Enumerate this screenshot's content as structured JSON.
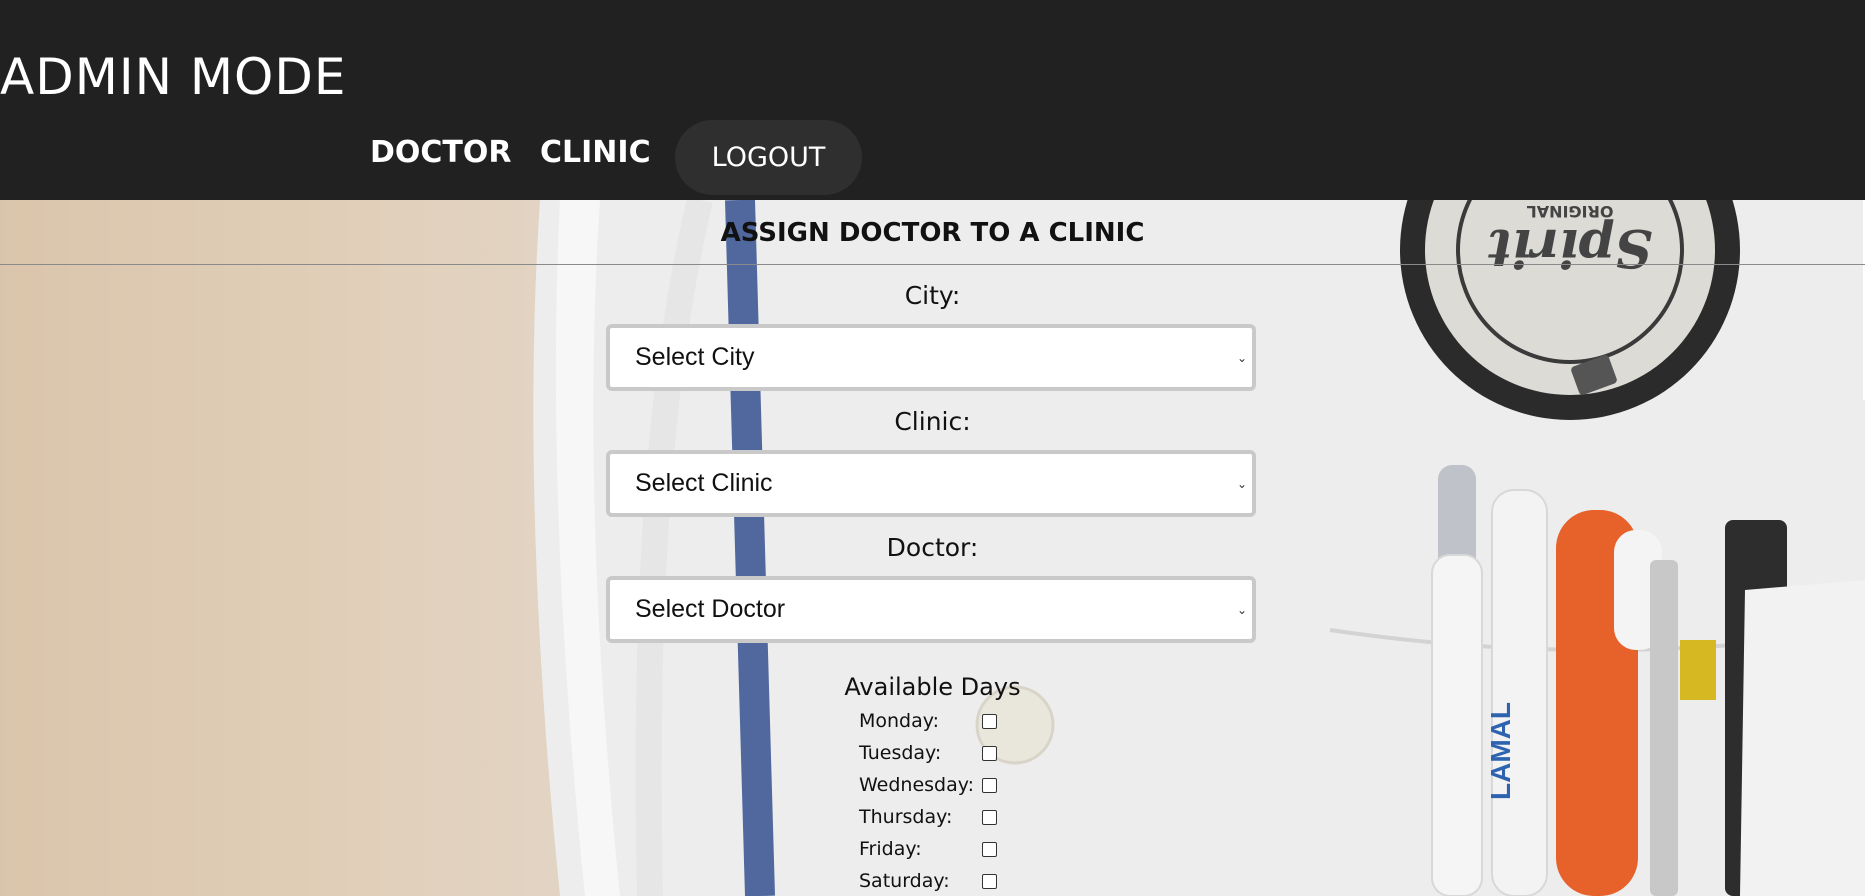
{
  "header": {
    "title": "ADMIN MODE",
    "nav": {
      "doctor_label": "DOCTOR",
      "clinic_label": "CLINIC",
      "logout_label": "LOGOUT"
    }
  },
  "form": {
    "title": "ASSIGN DOCTOR TO A CLINIC",
    "fields": [
      {
        "label": "City:",
        "value": "Select City"
      },
      {
        "label": "Clinic:",
        "value": "Select Clinic"
      },
      {
        "label": "Doctor:",
        "value": "Select Doctor"
      }
    ],
    "days_title": "Available Days",
    "days": [
      {
        "label": "Monday:",
        "checked": false
      },
      {
        "label": "Tuesday:",
        "checked": false
      },
      {
        "label": "Wednesday:",
        "checked": false
      },
      {
        "label": "Thursday:",
        "checked": false
      },
      {
        "label": "Friday:",
        "checked": false
      },
      {
        "label": "Saturday:",
        "checked": false
      }
    ]
  },
  "background_photo": {
    "badge_text": "Spirit",
    "badge_subtext": "ORIGINAL",
    "pen_text": "LAMAL"
  },
  "colors": {
    "header_bg": "#212121",
    "logout_bg": "#2f2f2f",
    "select_border": "#c9c9c9"
  }
}
